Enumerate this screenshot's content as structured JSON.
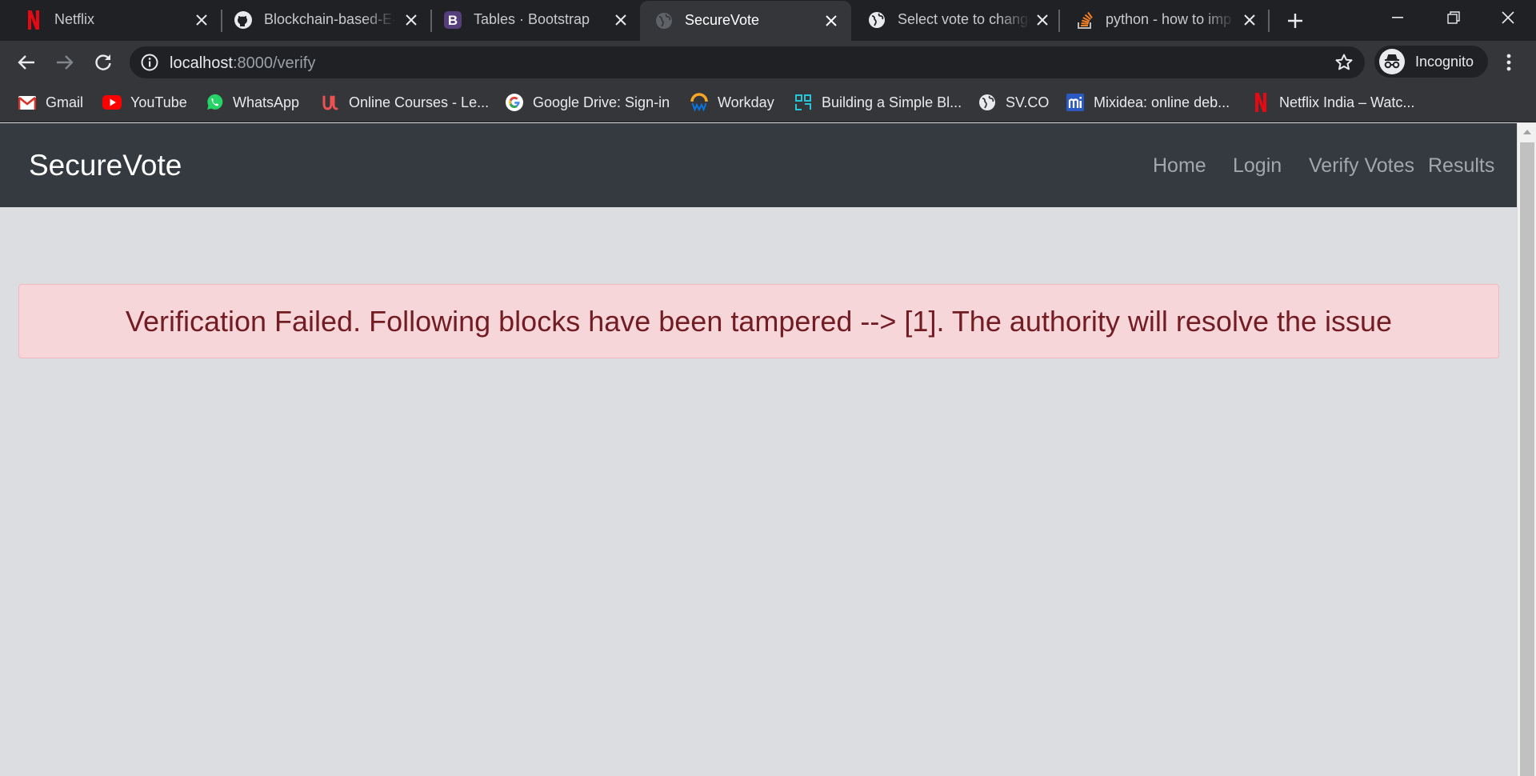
{
  "browser": {
    "tabs": [
      {
        "title": "Netflix",
        "icon": "netflix-icon",
        "active": false
      },
      {
        "title": "Blockchain-based-E-V",
        "icon": "github-icon",
        "active": false
      },
      {
        "title": "Tables · Bootstrap",
        "icon": "bootstrap-icon",
        "active": false
      },
      {
        "title": "SecureVote",
        "icon": "globe-icon",
        "active": true
      },
      {
        "title": "Select vote to change",
        "icon": "globe-icon",
        "active": false
      },
      {
        "title": "python - how to imp",
        "icon": "stackoverflow-icon",
        "active": false
      }
    ],
    "address": {
      "host": "localhost",
      "path": ":8000/verify"
    },
    "profile_label": "Incognito",
    "bookmarks": [
      {
        "label": "Gmail",
        "icon": "gmail-icon"
      },
      {
        "label": "YouTube",
        "icon": "youtube-icon"
      },
      {
        "label": "WhatsApp",
        "icon": "whatsapp-icon"
      },
      {
        "label": "Online Courses - Le...",
        "icon": "udemy-icon"
      },
      {
        "label": "Google Drive: Sign-in",
        "icon": "google-icon"
      },
      {
        "label": "Workday",
        "icon": "workday-icon"
      },
      {
        "label": "Building a Simple Bl...",
        "icon": "bookmark-site-icon"
      },
      {
        "label": "SV.CO",
        "icon": "globe-icon"
      },
      {
        "label": "Mixidea: online deb...",
        "icon": "mixidea-icon"
      },
      {
        "label": "Netflix India – Watc...",
        "icon": "netflix-icon"
      }
    ]
  },
  "page": {
    "brand": "SecureVote",
    "nav": [
      "Home",
      "Login",
      "Verify Votes",
      "Results"
    ],
    "alert": {
      "message": "Verification Failed. Following blocks have been tampered --> [1]. The authority will resolve the issue"
    }
  },
  "colors": {
    "navbar": "#343a40",
    "alert_bg": "#f8d7da",
    "alert_text": "#721c24",
    "page_bg": "#dcdde0"
  }
}
